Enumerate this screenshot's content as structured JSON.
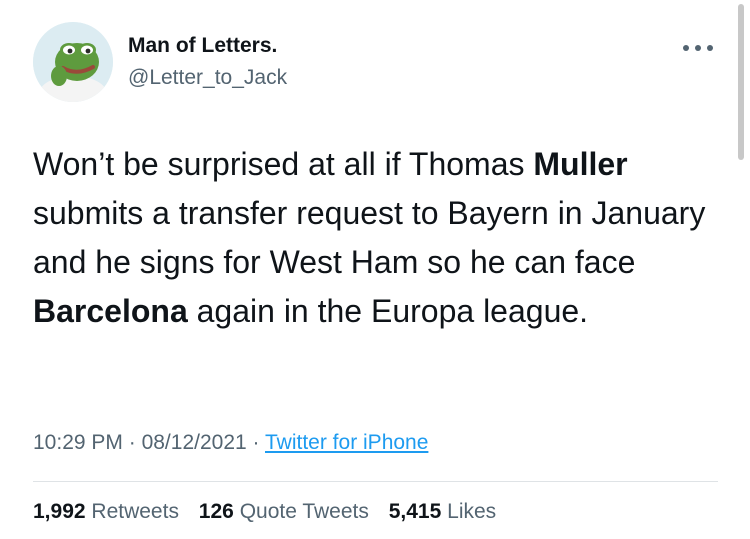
{
  "author": {
    "display_name": "Man of Letters.",
    "handle": "@Letter_to_Jack"
  },
  "tweet": {
    "segments": [
      {
        "text": "Won’t be surprised at all if Thomas ",
        "bold": false
      },
      {
        "text": "Muller",
        "bold": true
      },
      {
        "text": " submits a transfer request to Bayern in January and he signs for West Ham so he can face ",
        "bold": false
      },
      {
        "text": "Barcelona",
        "bold": true
      },
      {
        "text": " again in the Europa league.",
        "bold": false
      }
    ]
  },
  "meta": {
    "time": "10:29 PM",
    "separator": "·",
    "date": "08/12/2021",
    "source": "Twitter for iPhone"
  },
  "stats": {
    "retweets": {
      "count": "1,992",
      "label": "Retweets"
    },
    "quote_tweets": {
      "count": "126",
      "label": "Quote Tweets"
    },
    "likes": {
      "count": "5,415",
      "label": "Likes"
    }
  },
  "icons": {
    "more": "more-options-icon",
    "avatar": "frog-avatar"
  },
  "colors": {
    "text": "#0f1419",
    "secondary": "#536471",
    "link": "#1d9bf0"
  }
}
